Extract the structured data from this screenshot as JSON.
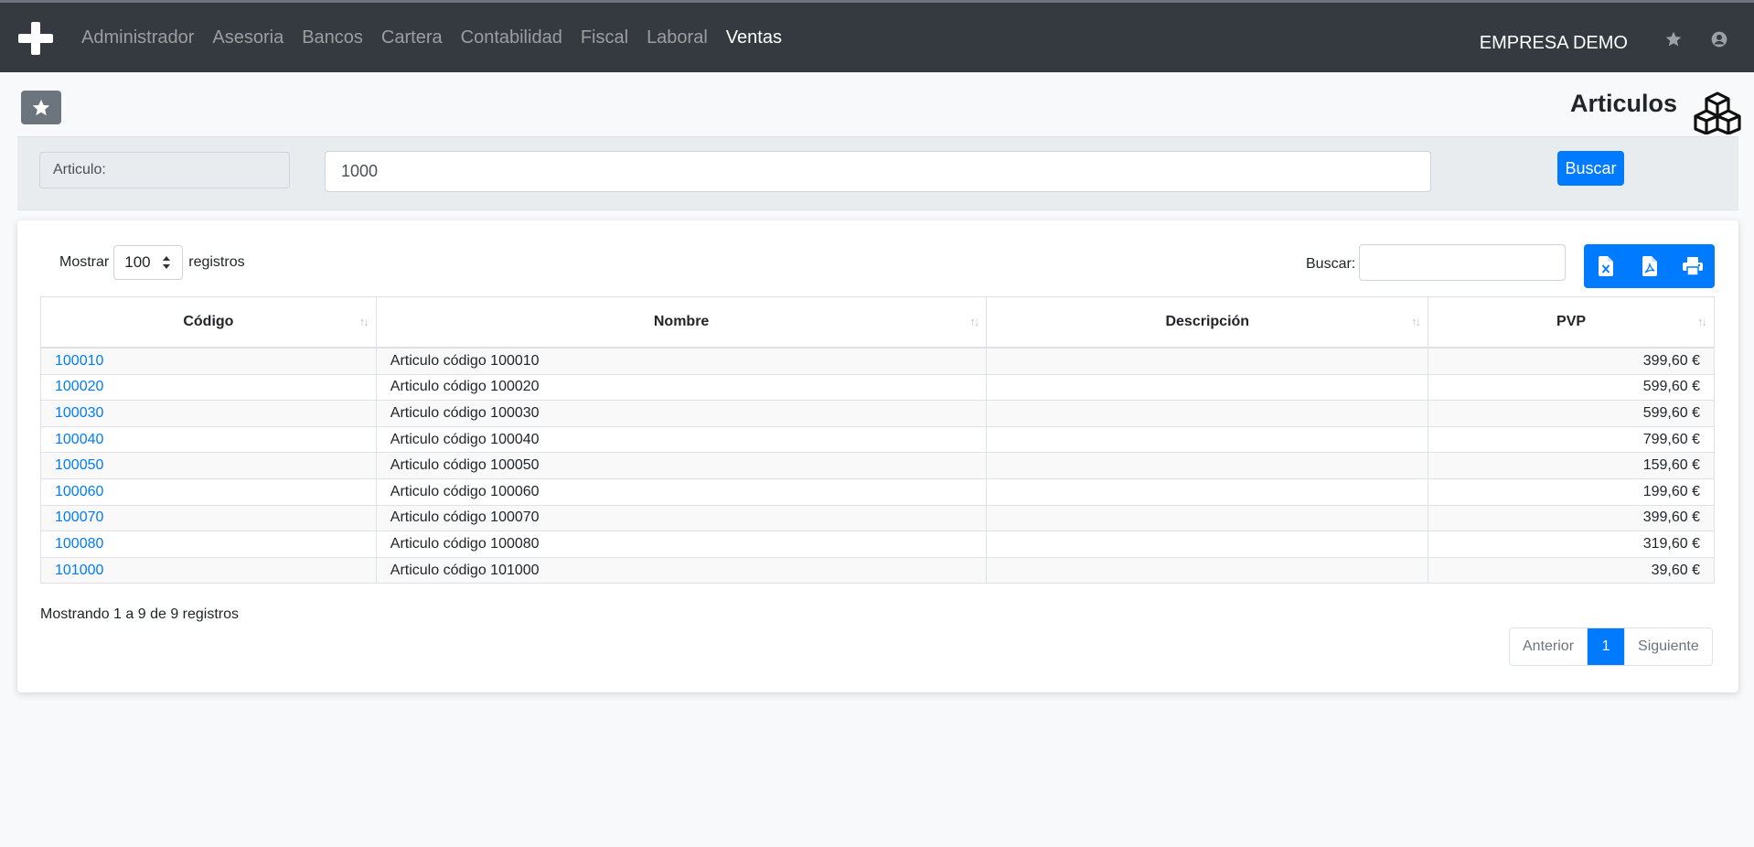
{
  "nav": {
    "links": [
      "Administrador",
      "Asesoria",
      "Bancos",
      "Cartera",
      "Contabilidad",
      "Fiscal",
      "Laboral",
      "Ventas"
    ],
    "active": "Ventas",
    "company": "EMPRESA DEMO"
  },
  "page": {
    "title": "Articulos"
  },
  "search": {
    "label": "Articulo:",
    "value": "1000",
    "button": "Buscar"
  },
  "table_controls": {
    "show_prefix": "Mostrar",
    "page_length": "100",
    "show_suffix": "registros",
    "filter_label": "Buscar:",
    "filter_value": ""
  },
  "table": {
    "headers": [
      "Código",
      "Nombre",
      "Descripción",
      "PVP"
    ],
    "rows": [
      {
        "codigo": "100010",
        "nombre": "Articulo código 100010",
        "descripcion": "",
        "pvp": "399,60 €"
      },
      {
        "codigo": "100020",
        "nombre": "Articulo código 100020",
        "descripcion": "",
        "pvp": "599,60 €"
      },
      {
        "codigo": "100030",
        "nombre": "Articulo código 100030",
        "descripcion": "",
        "pvp": "599,60 €"
      },
      {
        "codigo": "100040",
        "nombre": "Articulo código 100040",
        "descripcion": "",
        "pvp": "799,60 €"
      },
      {
        "codigo": "100050",
        "nombre": "Articulo código 100050",
        "descripcion": "",
        "pvp": "159,60 €"
      },
      {
        "codigo": "100060",
        "nombre": "Articulo código 100060",
        "descripcion": "",
        "pvp": "199,60 €"
      },
      {
        "codigo": "100070",
        "nombre": "Articulo código 100070",
        "descripcion": "",
        "pvp": "399,60 €"
      },
      {
        "codigo": "100080",
        "nombre": "Articulo código 100080",
        "descripcion": "",
        "pvp": "319,60 €"
      },
      {
        "codigo": "101000",
        "nombre": "Articulo código 101000",
        "descripcion": "",
        "pvp": "39,60 €"
      }
    ]
  },
  "footer": {
    "info": "Mostrando 1 a 9 de 9 registros",
    "prev": "Anterior",
    "current_page": "1",
    "next": "Siguiente"
  },
  "icons": {
    "brand": "plus-icon",
    "nav_star": "star-icon",
    "nav_user": "user-circle-icon",
    "favorite": "star-icon",
    "page": "boxes-icon",
    "export": [
      "file-excel-icon",
      "file-pdf-icon",
      "print-icon"
    ]
  },
  "colors": {
    "navbar": "#343a40",
    "primary": "#007bff",
    "secondary": "#6c757d"
  }
}
